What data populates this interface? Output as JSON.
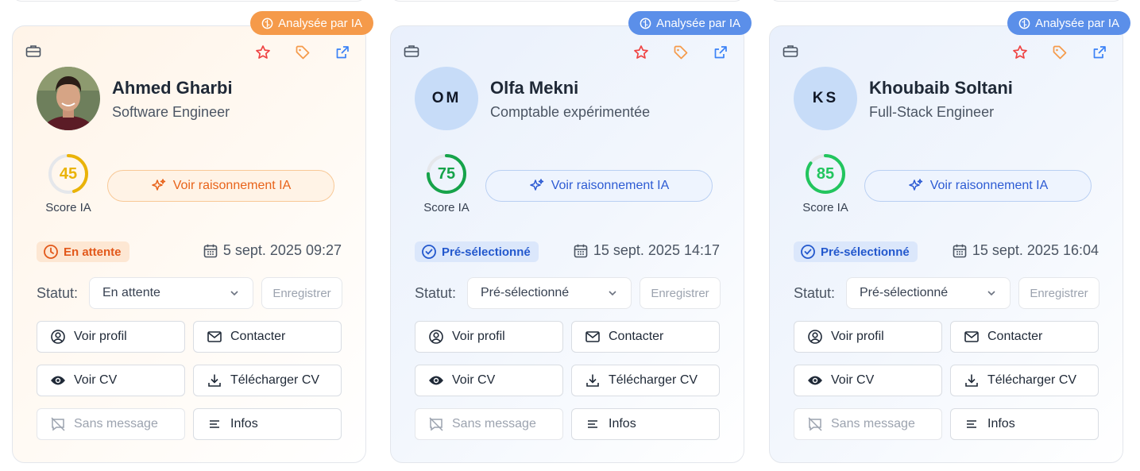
{
  "ai_badge_label": "Analysée par IA",
  "score_label": "Score IA",
  "reasoning_label": "Voir raisonnement IA",
  "statut_label": "Statut:",
  "save_label": "Enregistrer",
  "actions": {
    "view_profile": "Voir profil",
    "contact": "Contacter",
    "view_cv": "Voir CV",
    "download_cv": "Télécharger CV",
    "no_message": "Sans message",
    "info": "Infos"
  },
  "colors": {
    "orange_accent": "#e8631a",
    "blue_accent": "#2d5bd3",
    "score_45": "#eab308",
    "score_75": "#16a34a",
    "score_85": "#22c55e"
  },
  "candidates": [
    {
      "name": "Ahmed Gharbi",
      "role": "Software Engineer",
      "initials": "",
      "score": 45,
      "status_badge": "En attente",
      "date": "5 sept. 2025 09:27",
      "status_select": "En attente"
    },
    {
      "name": "Olfa Mekni",
      "role": "Comptable expérimentée",
      "initials": "OM",
      "score": 75,
      "status_badge": "Pré-sélectionné",
      "date": "15 sept. 2025 14:17",
      "status_select": "Pré-sélectionné"
    },
    {
      "name": "Khoubaib Soltani",
      "role": "Full-Stack Engineer",
      "initials": "KS",
      "score": 85,
      "status_badge": "Pré-sélectionné",
      "date": "15 sept. 2025 16:04",
      "status_select": "Pré-sélectionné"
    }
  ]
}
